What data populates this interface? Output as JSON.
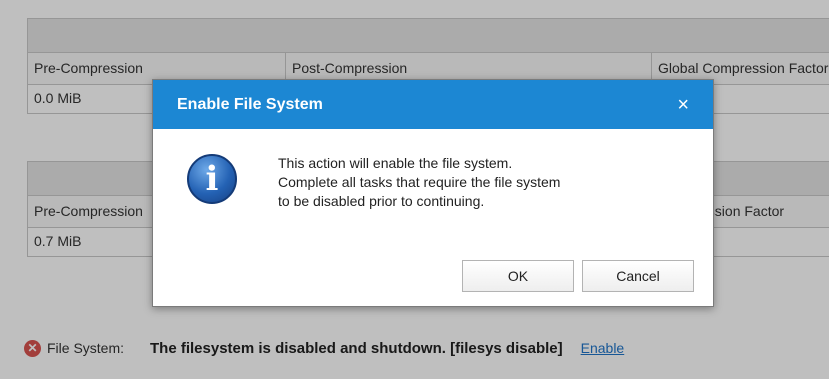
{
  "tables": [
    {
      "headers": [
        "Pre-Compression",
        "Post-Compression",
        "Global Compression Factor"
      ],
      "row": [
        "0.0 MiB",
        "",
        ""
      ]
    },
    {
      "headers": [
        "Pre-Compression",
        "",
        "Compression Factor"
      ],
      "row": [
        "0.7 MiB",
        "",
        ""
      ]
    }
  ],
  "status": {
    "label": "File System:",
    "message": "The filesystem is disabled and shutdown. [filesys disable]",
    "link": "Enable"
  },
  "dialog": {
    "title": "Enable File System",
    "close": "×",
    "icon": "info-icon",
    "lines": [
      "This action will enable the file system.",
      "Complete all tasks that require the file system",
      "to be disabled prior to continuing."
    ],
    "ok_label": "OK",
    "cancel_label": "Cancel"
  },
  "colors": {
    "title_bar": "#1c87d3",
    "link": "#1f74c9",
    "error": "#d9534f"
  }
}
